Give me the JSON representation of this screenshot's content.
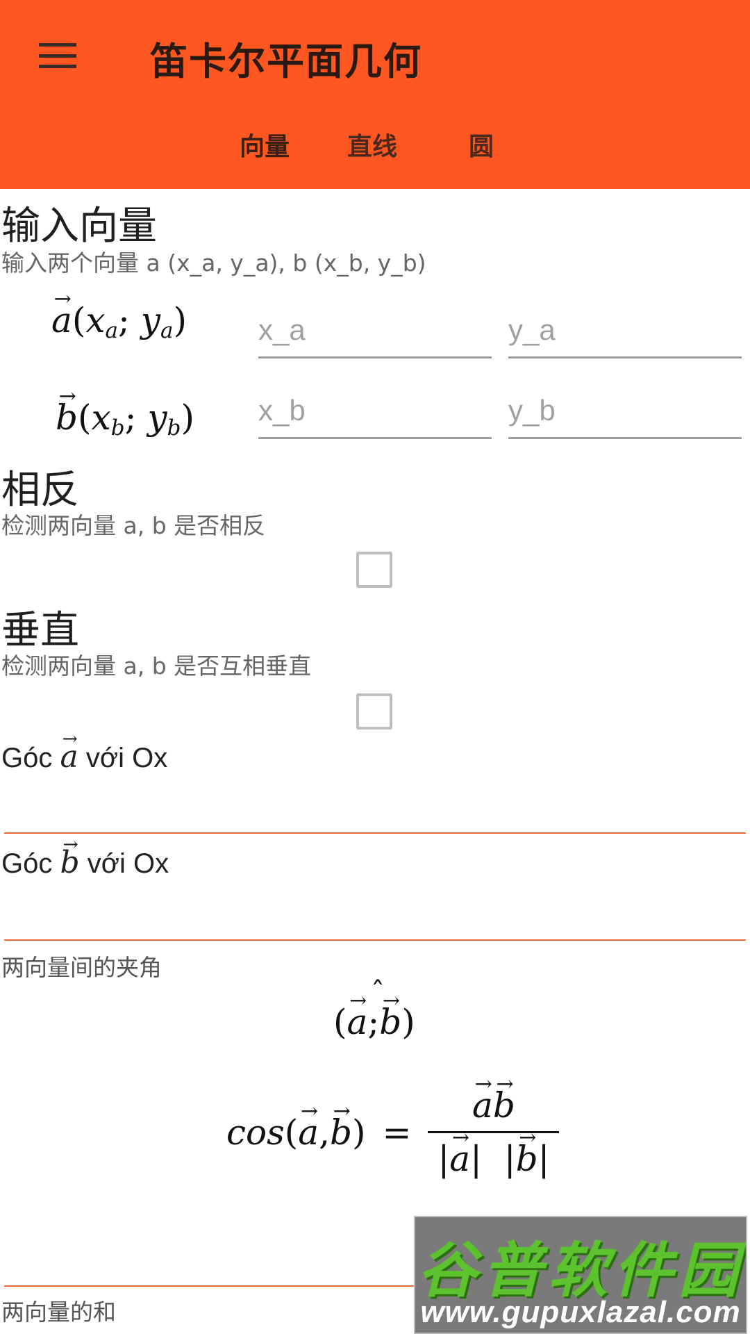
{
  "app": {
    "title": "笛卡尔平面几何"
  },
  "tabs": [
    {
      "label": "向量"
    },
    {
      "label": "直线"
    },
    {
      "label": "圆"
    }
  ],
  "input_section": {
    "title": "输入向量",
    "subtitle": "输入两个向量 a (x_a, y_a), b (x_b, y_b)",
    "vector_a": {
      "symbol": "a",
      "coord1": "x",
      "coord1_sub": "a",
      "coord2": "y",
      "coord2_sub": "a",
      "x_placeholder": "x_a",
      "y_placeholder": "y_a",
      "x_value": "",
      "y_value": ""
    },
    "vector_b": {
      "symbol": "b",
      "coord1": "x",
      "coord1_sub": "b",
      "coord2": "y",
      "coord2_sub": "b",
      "x_placeholder": "x_b",
      "y_placeholder": "y_b",
      "x_value": "",
      "y_value": ""
    }
  },
  "opposite_section": {
    "title": "相反",
    "subtitle": "检测两向量 a, b 是否相反",
    "checked": false
  },
  "perpendicular_section": {
    "title": "垂直",
    "subtitle": "检测两向量 a, b 是否互相垂直",
    "checked": false
  },
  "angles": {
    "a_prefix": "Góc",
    "a_symbol": "a",
    "a_suffix": "với Ox",
    "b_prefix": "Góc",
    "b_symbol": "b",
    "b_suffix": "với Ox"
  },
  "between": {
    "label": "两向量间的夹角",
    "formula_lhs_fn": "cos",
    "a": "a",
    "b": "b",
    "hat": "ˆ"
  },
  "sum_section": {
    "label": "两向量的和"
  },
  "watermark": {
    "top": "谷普软件园",
    "bottom": "www.gupuxlazal.com"
  },
  "colors": {
    "appbar": "#FF5722",
    "accent_line": "#E86A3A",
    "watermark_green": "#5CC22E"
  }
}
